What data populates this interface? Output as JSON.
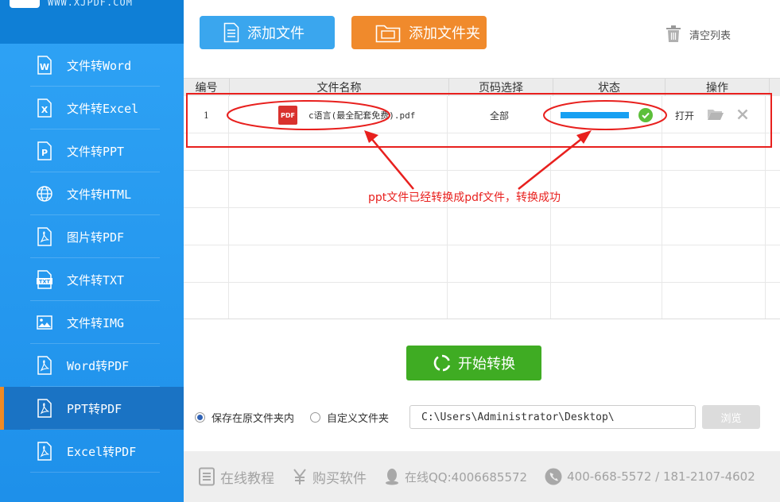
{
  "brand": {
    "site_text": "WWW.XJPDF.COM"
  },
  "sidebar": {
    "items": [
      {
        "label": "文件转Word",
        "icon": "word-icon"
      },
      {
        "label": "文件转Excel",
        "icon": "excel-icon"
      },
      {
        "label": "文件转PPT",
        "icon": "ppt-icon"
      },
      {
        "label": "文件转HTML",
        "icon": "globe-icon"
      },
      {
        "label": "图片转PDF",
        "icon": "pdf-icon"
      },
      {
        "label": "文件转TXT",
        "icon": "txt-icon"
      },
      {
        "label": "文件转IMG",
        "icon": "image-icon"
      },
      {
        "label": "Word转PDF",
        "icon": "pdf-icon"
      },
      {
        "label": "PPT转PDF",
        "icon": "pdf-icon",
        "active": true
      },
      {
        "label": "Excel转PDF",
        "icon": "pdf-icon"
      }
    ]
  },
  "toolbar": {
    "add_file_label": "添加文件",
    "add_folder_label": "添加文件夹",
    "clear_list_label": "清空列表"
  },
  "table": {
    "headers": [
      "编号",
      "文件名称",
      "页码选择",
      "状态",
      "操作"
    ],
    "rows": [
      {
        "index": "1",
        "file_name": "c语言(最全配套免费).pdf",
        "pages": "全部",
        "progress": 1.0,
        "status_icon": "check-circle-icon",
        "open_label": "打开"
      }
    ]
  },
  "annotation": {
    "text": "ppt文件已经转换成pdf文件，转换成功"
  },
  "start_button": {
    "label": "开始转换"
  },
  "save_options": {
    "option_original": "保存在原文件夹内",
    "option_custom": "自定义文件夹",
    "selected": "original",
    "path_value": "C:\\Users\\Administrator\\Desktop\\",
    "browse_label": "浏览"
  },
  "footer": {
    "tutorial": "在线教程",
    "buy": "购买软件",
    "qq": "在线QQ:4006685572",
    "phone": "400-668-5572 / 181-2107-4602"
  },
  "colors": {
    "sidebar_bg": "#2fa3f5",
    "active_indicator": "#f08a24",
    "add_file_btn": "#3aa6ee",
    "add_folder_btn": "#f08a2c",
    "start_btn": "#3fac23",
    "progress": "#18a0f2",
    "success": "#5cbf3a",
    "annotation": "#e8201e"
  }
}
